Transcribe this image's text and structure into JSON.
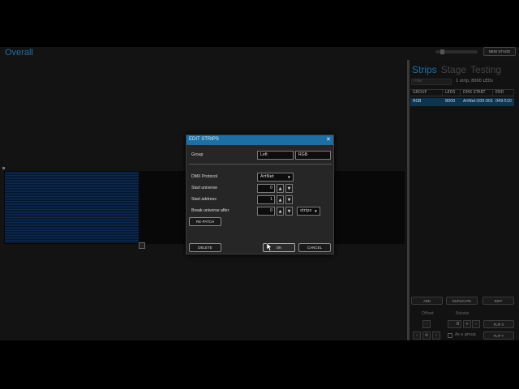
{
  "header": {
    "title": "Overall",
    "new_stage_label": "NEW STAGE"
  },
  "panel": {
    "tabs": [
      {
        "label": "Strips",
        "active": true
      },
      {
        "label": "Stage",
        "active": false
      },
      {
        "label": "Testing",
        "active": false
      }
    ],
    "filter_placeholder": "Filter",
    "summary": "1 strip, 8000 LEDs",
    "table": {
      "columns": [
        "GROUP",
        "LEDS",
        "DMX START",
        "END"
      ],
      "rows": [
        {
          "group": "RGB",
          "leds": "8000",
          "dmx_start": "ArtNet:000:001",
          "end": "049:510"
        }
      ]
    },
    "buttons": {
      "add": "ADD",
      "duplicate": "DUPLICATE",
      "edit": "EDIT"
    },
    "offset_label": "Offset",
    "rotate_label": "Rotate",
    "rotate_value": "0",
    "flip_x": "FLIP X",
    "flip_y": "FLIP Y",
    "as_group_label": "As a group"
  },
  "dialog": {
    "title": "EDIT STRIPS",
    "close_glyph": "✕",
    "group_label": "Group",
    "group_value": "Left",
    "group_type_value": "RGB",
    "protocol_label": "DMX Protocol",
    "protocol_value": "ArtNet",
    "start_universe_label": "Start universe",
    "start_universe_value": "0",
    "start_address_label": "Start address",
    "start_address_value": "1",
    "break_label": "Break universe after",
    "break_value": "0",
    "break_unit_value": "strips",
    "repatch_label": "RE-PATCH",
    "delete_label": "DELETE",
    "ok_label": "OK",
    "cancel_label": "CANCEL"
  },
  "colors": {
    "accent": "#1c6fa4",
    "strip_fill": "#0c2a52"
  }
}
